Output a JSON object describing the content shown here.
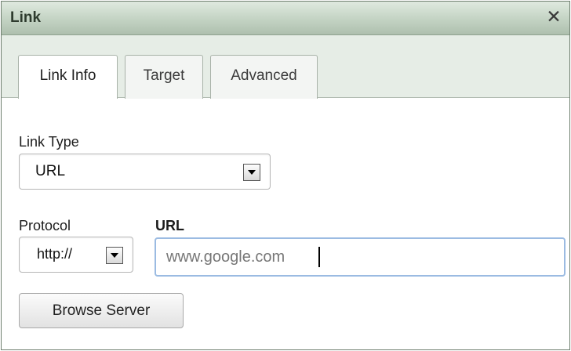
{
  "dialog": {
    "title": "Link",
    "close_label": "✕"
  },
  "tabs": [
    {
      "label": "Link Info",
      "active": true
    },
    {
      "label": "Target",
      "active": false
    },
    {
      "label": "Advanced",
      "active": false
    }
  ],
  "form": {
    "link_type_label": "Link Type",
    "link_type_value": "URL",
    "protocol_label": "Protocol",
    "protocol_value": "http://",
    "url_label": "URL",
    "url_value": "www.google.com",
    "browse_button": "Browse Server"
  }
}
